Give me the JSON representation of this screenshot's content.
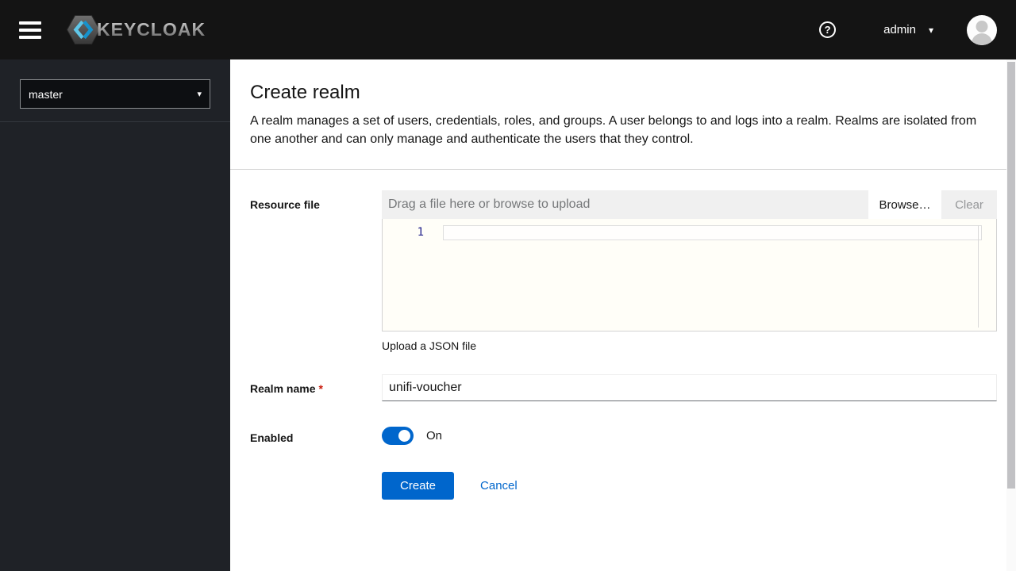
{
  "header": {
    "brand": "KEYCLOAK",
    "help_glyph": "?",
    "username": "admin",
    "caret": "▾"
  },
  "sidebar": {
    "realm": "master",
    "caret": "▾"
  },
  "page": {
    "title": "Create realm",
    "description": "A realm manages a set of users, credentials, roles, and groups. A user belongs to and logs into a realm. Realms are isolated from one another and can only manage and authenticate the users that they control."
  },
  "form": {
    "resource_file": {
      "label": "Resource file",
      "placeholder": "Drag a file here or browse to upload",
      "browse_label": "Browse…",
      "clear_label": "Clear",
      "line_number": "1",
      "helper": "Upload a JSON file"
    },
    "realm_name": {
      "label": "Realm name",
      "required_marker": "*",
      "value": "unifi-voucher"
    },
    "enabled": {
      "label": "Enabled",
      "state": "On"
    },
    "actions": {
      "create": "Create",
      "cancel": "Cancel"
    }
  },
  "colors": {
    "accent": "#0066cc",
    "masthead_bg": "#141414",
    "sidebar_bg": "#1f2227",
    "required": "#c9190b",
    "editor_bg": "#fffef8"
  }
}
